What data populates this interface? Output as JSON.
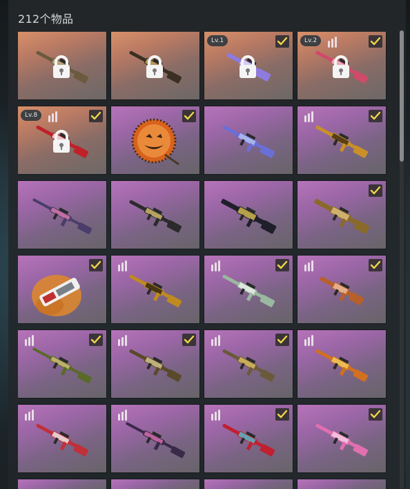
{
  "inventory": {
    "item_count_label": "212个物品",
    "accent_check_color": "#f2d64b",
    "rarity_colors": {
      "orange": "#d8906a",
      "purple": "#b673b9"
    },
    "items": [
      {
        "rarity": "orange",
        "weapon": "rifle",
        "skin": [
          "#6b5a3e",
          "#c9b88a"
        ],
        "locked": true,
        "checked": false,
        "level": null,
        "bars": false
      },
      {
        "rarity": "orange",
        "weapon": "rifle",
        "skin": [
          "#3a2f22",
          "#d4b46b"
        ],
        "locked": true,
        "checked": false,
        "level": null,
        "bars": false
      },
      {
        "rarity": "orange",
        "weapon": "smg",
        "skin": [
          "#8d7be0",
          "#e8e0f5"
        ],
        "locked": true,
        "checked": true,
        "level": "Lv.1",
        "bars": false
      },
      {
        "rarity": "orange",
        "weapon": "rifle",
        "skin": [
          "#d04a6a",
          "#f3c1cf"
        ],
        "locked": true,
        "checked": true,
        "level": "Lv.2",
        "bars": true
      },
      {
        "rarity": "orange",
        "weapon": "rifle",
        "skin": [
          "#c0202a",
          "#f2f2f2"
        ],
        "locked": true,
        "checked": true,
        "level": "Lv.8",
        "bars": true
      },
      {
        "rarity": "purple",
        "weapon": "pumpkin",
        "skin": [
          "#d8621c",
          "#3a2010"
        ],
        "locked": false,
        "checked": true,
        "level": null,
        "bars": false
      },
      {
        "rarity": "purple",
        "weapon": "rifle",
        "skin": [
          "#6a6fd8",
          "#b8c4f0"
        ],
        "locked": false,
        "checked": false,
        "level": null,
        "bars": false
      },
      {
        "rarity": "purple",
        "weapon": "rifle",
        "skin": [
          "#c9902a",
          "#3b2a12"
        ],
        "locked": false,
        "checked": true,
        "level": null,
        "bars": true
      },
      {
        "rarity": "purple",
        "weapon": "shotgun",
        "skin": [
          "#4a3d6a",
          "#e07ab0"
        ],
        "locked": false,
        "checked": false,
        "level": null,
        "bars": false
      },
      {
        "rarity": "purple",
        "weapon": "rifle",
        "skin": [
          "#2a2a2a",
          "#d8c070"
        ],
        "locked": false,
        "checked": false,
        "level": null,
        "bars": false
      },
      {
        "rarity": "purple",
        "weapon": "lmg",
        "skin": [
          "#1f1f2a",
          "#d8c050"
        ],
        "locked": false,
        "checked": false,
        "level": null,
        "bars": false
      },
      {
        "rarity": "purple",
        "weapon": "lmg",
        "skin": [
          "#8a6a2a",
          "#e0c080"
        ],
        "locked": false,
        "checked": true,
        "level": null,
        "bars": false
      },
      {
        "rarity": "purple",
        "weapon": "launcher",
        "skin": [
          "#e08a30",
          "#f0f0f0"
        ],
        "locked": false,
        "checked": true,
        "level": null,
        "bars": false
      },
      {
        "rarity": "purple",
        "weapon": "rifle",
        "skin": [
          "#c08a20",
          "#2a2010"
        ],
        "locked": false,
        "checked": false,
        "level": null,
        "bars": true
      },
      {
        "rarity": "purple",
        "weapon": "rifle",
        "skin": [
          "#9ab8a0",
          "#eef2ee"
        ],
        "locked": false,
        "checked": true,
        "level": null,
        "bars": true
      },
      {
        "rarity": "purple",
        "weapon": "smg",
        "skin": [
          "#b8602a",
          "#f0c0a0"
        ],
        "locked": false,
        "checked": true,
        "level": null,
        "bars": true
      },
      {
        "rarity": "purple",
        "weapon": "shotgun",
        "skin": [
          "#5a6a2a",
          "#d8c080"
        ],
        "locked": false,
        "checked": true,
        "level": null,
        "bars": true
      },
      {
        "rarity": "purple",
        "weapon": "rifle",
        "skin": [
          "#5a4a2a",
          "#d8c890"
        ],
        "locked": false,
        "checked": true,
        "level": null,
        "bars": true
      },
      {
        "rarity": "purple",
        "weapon": "rifle",
        "skin": [
          "#6a5a3a",
          "#e0c060"
        ],
        "locked": false,
        "checked": true,
        "level": null,
        "bars": true
      },
      {
        "rarity": "purple",
        "weapon": "rifle",
        "skin": [
          "#d07020",
          "#f0d060"
        ],
        "locked": false,
        "checked": false,
        "level": null,
        "bars": true
      },
      {
        "rarity": "purple",
        "weapon": "rifle",
        "skin": [
          "#c0303a",
          "#f0f0f0"
        ],
        "locked": false,
        "checked": false,
        "level": null,
        "bars": true
      },
      {
        "rarity": "purple",
        "weapon": "shotgun",
        "skin": [
          "#3a2a4a",
          "#e070b0"
        ],
        "locked": false,
        "checked": false,
        "level": null,
        "bars": true
      },
      {
        "rarity": "purple",
        "weapon": "rifle",
        "skin": [
          "#c02030",
          "#50c0d0"
        ],
        "locked": false,
        "checked": true,
        "level": null,
        "bars": true
      },
      {
        "rarity": "purple",
        "weapon": "rifle",
        "skin": [
          "#e070b0",
          "#f6d0e6"
        ],
        "locked": false,
        "checked": true,
        "level": null,
        "bars": false
      },
      {
        "rarity": "purple",
        "weapon": "none",
        "skin": [
          "#000",
          "#000"
        ],
        "locked": false,
        "checked": false,
        "level": null,
        "bars": false
      },
      {
        "rarity": "purple",
        "weapon": "none",
        "skin": [
          "#000",
          "#000"
        ],
        "locked": false,
        "checked": false,
        "level": null,
        "bars": false
      },
      {
        "rarity": "purple",
        "weapon": "none",
        "skin": [
          "#000",
          "#000"
        ],
        "locked": false,
        "checked": false,
        "level": null,
        "bars": false
      },
      {
        "rarity": "purple",
        "weapon": "none",
        "skin": [
          "#000",
          "#000"
        ],
        "locked": false,
        "checked": false,
        "level": null,
        "bars": false
      }
    ]
  }
}
